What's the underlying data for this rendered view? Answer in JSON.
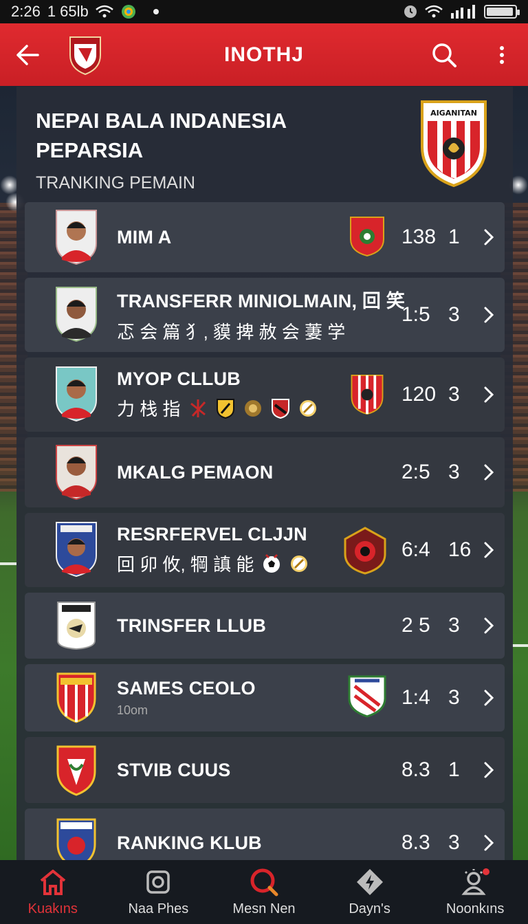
{
  "status_bar": {
    "time": "2:26",
    "extra": "1 65lb"
  },
  "app_bar": {
    "title": "INOTHJ"
  },
  "header": {
    "title": "NEPAI BALA INDANESIA PEPARSIA",
    "subtitle": "TRANKING PEMAIN",
    "crest_text": "AIGANITAN"
  },
  "rows": [
    {
      "name": "MIM A",
      "sub": "",
      "score": "138",
      "rank": "1"
    },
    {
      "name": "TRANSFERR MINIOLMAIN, 回 笑",
      "sub": "忑 会 篇 ⺨, 貘 捭 赦 会 萋 学",
      "score": "1:5",
      "rank": "3"
    },
    {
      "name": "MYOP CLLUB",
      "sub": "力 栈 指",
      "score": "120",
      "rank": "3"
    },
    {
      "name": "MKALG PEMAON",
      "sub": "",
      "score": "2:5",
      "rank": "3"
    },
    {
      "name": "RESRFERVEL CLJJN",
      "sub": "回 卯 攸, 犅 謓 能",
      "score": "6:4",
      "rank": "16"
    },
    {
      "name": "TRINSFER LLUB",
      "sub": "",
      "score": "2 5",
      "rank": "3"
    },
    {
      "name": "SAMES CEOLO",
      "sub": "10om",
      "score": "1:4",
      "rank": "3"
    },
    {
      "name": "STVIB CUUS",
      "sub": "",
      "score": "8.3",
      "rank": "1"
    },
    {
      "name": "RANKING KLUB",
      "sub": "",
      "score": "8.3",
      "rank": "3"
    }
  ],
  "bottom_nav": [
    {
      "label": "Kuakıns"
    },
    {
      "label": "Naa Phes"
    },
    {
      "label": "Mesn Nen"
    },
    {
      "label": "Dayn's"
    },
    {
      "label": "Noonkıns"
    }
  ],
  "colors": {
    "brand_red": "#d8242a",
    "panel": "#2e323b",
    "row": "#3b404a"
  }
}
